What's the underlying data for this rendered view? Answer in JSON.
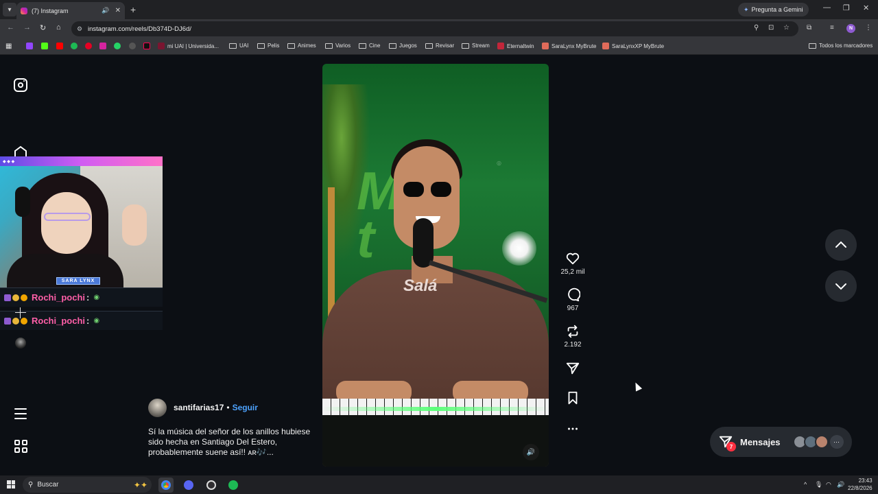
{
  "browser": {
    "tab_title": "(7) Instagram",
    "gemini_label": "Pregunta a Gemini",
    "url": "instagram.com/reels/Db374D-DJ6d/",
    "profile_initial": "N",
    "bookmarks": [
      {
        "label": "mi UAI | Universida...",
        "icon": "uai-icon"
      },
      {
        "label": "UAI",
        "icon": "folder-icon"
      },
      {
        "label": "Pelis",
        "icon": "folder-icon"
      },
      {
        "label": "Animes",
        "icon": "folder-icon"
      },
      {
        "label": "Varios",
        "icon": "folder-icon"
      },
      {
        "label": "Cine",
        "icon": "folder-icon"
      },
      {
        "label": "Juegos",
        "icon": "folder-icon"
      },
      {
        "label": "Revisar",
        "icon": "folder-icon"
      },
      {
        "label": "Stream",
        "icon": "folder-icon"
      },
      {
        "label": "Eternaltwin",
        "icon": "eternaltwin-icon"
      },
      {
        "label": "SaraLynx MyBrute",
        "icon": "mybrute-icon"
      },
      {
        "label": "SaraLynxXP MyBrute",
        "icon": "mybrute-icon"
      }
    ],
    "all_bookmarks_label": "Todos los marcadores"
  },
  "stream_overlay": {
    "cam_name": "SARA LYNX",
    "chat": [
      {
        "user": "Rochi_pochi",
        "sep": ":"
      },
      {
        "user": "Rochi_pochi",
        "sep": ":"
      }
    ]
  },
  "reel": {
    "actions": {
      "likes": "25,2 mil",
      "comments": "967",
      "reposts": "2.192"
    },
    "author": "santifarias17",
    "separator": "•",
    "follow_label": "Seguir",
    "caption": "Sí la música del señor de los anillos hubiese sido hecha en Santiago Del Estero, probablemente suene así!! ᴀʀ🎶..."
  },
  "messages": {
    "label": "Mensajes",
    "badge": "7"
  },
  "taskbar": {
    "search_placeholder": "Buscar",
    "time": "23:43",
    "date": "22/8/2026"
  },
  "colors": {
    "accent_link": "#4da3ff",
    "badge_red": "#ff3040",
    "chat_user": "#ff5fa8"
  }
}
